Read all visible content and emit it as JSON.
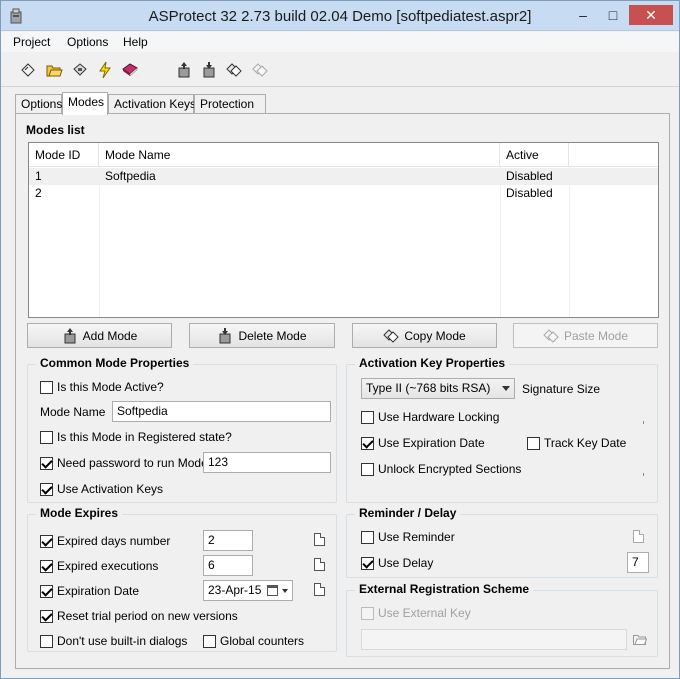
{
  "window": {
    "title": "ASProtect 32 2.73 build 02.04 Demo [softpediatest.aspr2]",
    "controls": {
      "minimize": "–",
      "maximize": "□",
      "close": "✕"
    }
  },
  "menu": [
    {
      "label": "Project"
    },
    {
      "label": "Options"
    },
    {
      "label": "Help"
    }
  ],
  "toolbar": {
    "icons": [
      "new-project-icon",
      "open-project-icon",
      "save-project-icon",
      "protect-icon",
      "help-book-icon",
      "add-mode-icon",
      "delete-mode-icon",
      "copy-mode-icon",
      "paste-mode-icon"
    ]
  },
  "tabs": [
    {
      "label": "Options"
    },
    {
      "label": "Modes"
    },
    {
      "label": "Activation Keys"
    },
    {
      "label": "Protection"
    }
  ],
  "modes_list": {
    "title": "Modes list",
    "columns": [
      "Mode ID",
      "Mode Name",
      "Active"
    ],
    "rows": [
      {
        "id": "1",
        "name": "Softpedia",
        "active": "Disabled"
      },
      {
        "id": "2",
        "name": "",
        "active": "Disabled"
      }
    ]
  },
  "mode_buttons": {
    "add": "Add Mode",
    "delete": "Delete Mode",
    "copy": "Copy Mode",
    "paste": "Paste Mode"
  },
  "common_props": {
    "title": "Common Mode Properties",
    "is_active_label": "Is this Mode Active?",
    "is_active_checked": false,
    "mode_name_label": "Mode Name",
    "mode_name_value": "Softpedia",
    "registered_label": "Is this Mode in Registered state?",
    "registered_checked": false,
    "need_password_label": "Need password to run Mode",
    "need_password_checked": true,
    "password_value": "123",
    "use_activation_label": "Use Activation Keys",
    "use_activation_checked": true
  },
  "activation_props": {
    "title": "Activation Key Properties",
    "key_type": "Type II  (~768 bits RSA)",
    "signature_label": "Signature Size",
    "hardware_label": "Use Hardware Locking",
    "hardware_checked": false,
    "expiration_label": "Use Expiration Date",
    "expiration_checked": true,
    "track_label": "Track Key Date",
    "track_checked": false,
    "unlock_label": "Unlock Encrypted Sections",
    "unlock_checked": false
  },
  "mode_expires": {
    "title": "Mode Expires",
    "days_label": "Expired days number",
    "days_checked": true,
    "days_value": "2",
    "executions_label": "Expired executions",
    "executions_checked": true,
    "executions_value": "6",
    "date_label": "Expiration Date",
    "date_checked": true,
    "date_value": "23-Apr-15",
    "reset_label": "Reset trial period on new versions",
    "reset_checked": true,
    "builtin_label": "Don't use built-in dialogs",
    "builtin_checked": false,
    "global_label": "Global counters",
    "global_checked": false
  },
  "reminder": {
    "title": "Reminder / Delay",
    "reminder_label": "Use Reminder",
    "reminder_checked": false,
    "delay_label": "Use Delay",
    "delay_checked": true,
    "delay_value": "7"
  },
  "external_reg": {
    "title": "External Registration Scheme",
    "use_label": "Use External Key",
    "use_checked": false,
    "path_value": ""
  }
}
